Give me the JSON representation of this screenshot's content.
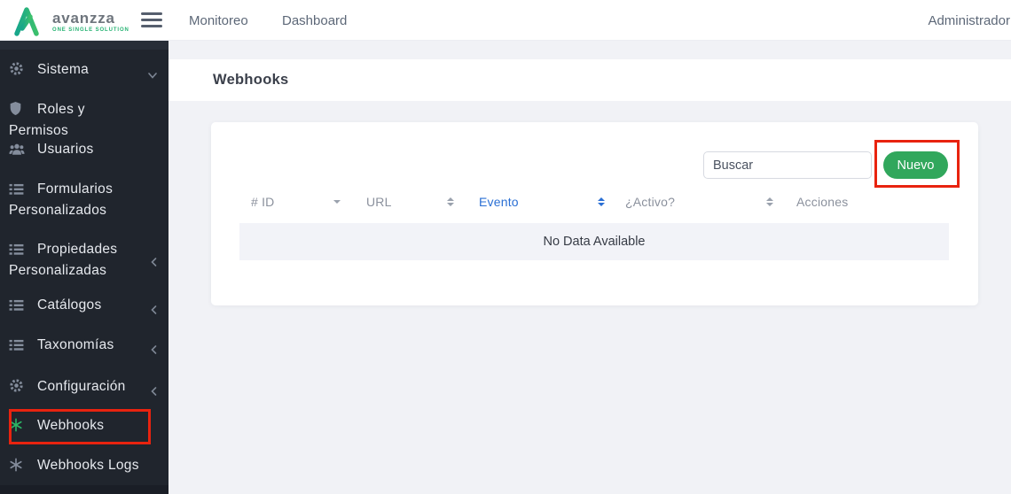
{
  "header": {
    "brand": "avanzza",
    "tagline": "ONE SINGLE SOLUTION",
    "nav": [
      {
        "label": "Monitoreo"
      },
      {
        "label": "Dashboard"
      }
    ],
    "user": "Administrador"
  },
  "sidebar": {
    "items": [
      {
        "label": "Sistema",
        "icon": "gear-icon",
        "chevron": "down"
      },
      {
        "label": "Roles y Permisos",
        "icon": "shield-icon"
      },
      {
        "label": "Usuarios",
        "icon": "users-icon"
      },
      {
        "label": "Formularios Personalizados",
        "icon": "list-icon"
      },
      {
        "label": "Propiedades Personalizadas",
        "icon": "list-icon",
        "chevron": "left"
      },
      {
        "label": "Catálogos",
        "icon": "list-icon",
        "chevron": "left"
      },
      {
        "label": "Taxonomías",
        "icon": "list-icon",
        "chevron": "left"
      },
      {
        "label": "Configuración",
        "icon": "gear-icon",
        "chevron": "left"
      },
      {
        "label": "Webhooks",
        "icon": "webhook-icon",
        "active": true,
        "annotated": true
      },
      {
        "label": "Webhooks Logs",
        "icon": "webhook-icon"
      }
    ]
  },
  "page": {
    "title": "Webhooks"
  },
  "toolbar": {
    "search_placeholder": "Buscar",
    "new_button": "Nuevo"
  },
  "table": {
    "columns": [
      {
        "label": "# ID",
        "sort": "desc"
      },
      {
        "label": "URL",
        "sort": "both"
      },
      {
        "label": "Evento",
        "sort": "both",
        "active": true
      },
      {
        "label": "¿Activo?",
        "sort": "both"
      },
      {
        "label": "Acciones",
        "sort": "none"
      }
    ],
    "empty": "No Data Available"
  },
  "colors": {
    "accent_green": "#31a75c",
    "icon_green": "#2bb565",
    "link_blue": "#2a6fd4",
    "annotation_red": "#e8230f",
    "sidebar_bg": "#20252d",
    "main_bg": "#f1f2f6"
  }
}
